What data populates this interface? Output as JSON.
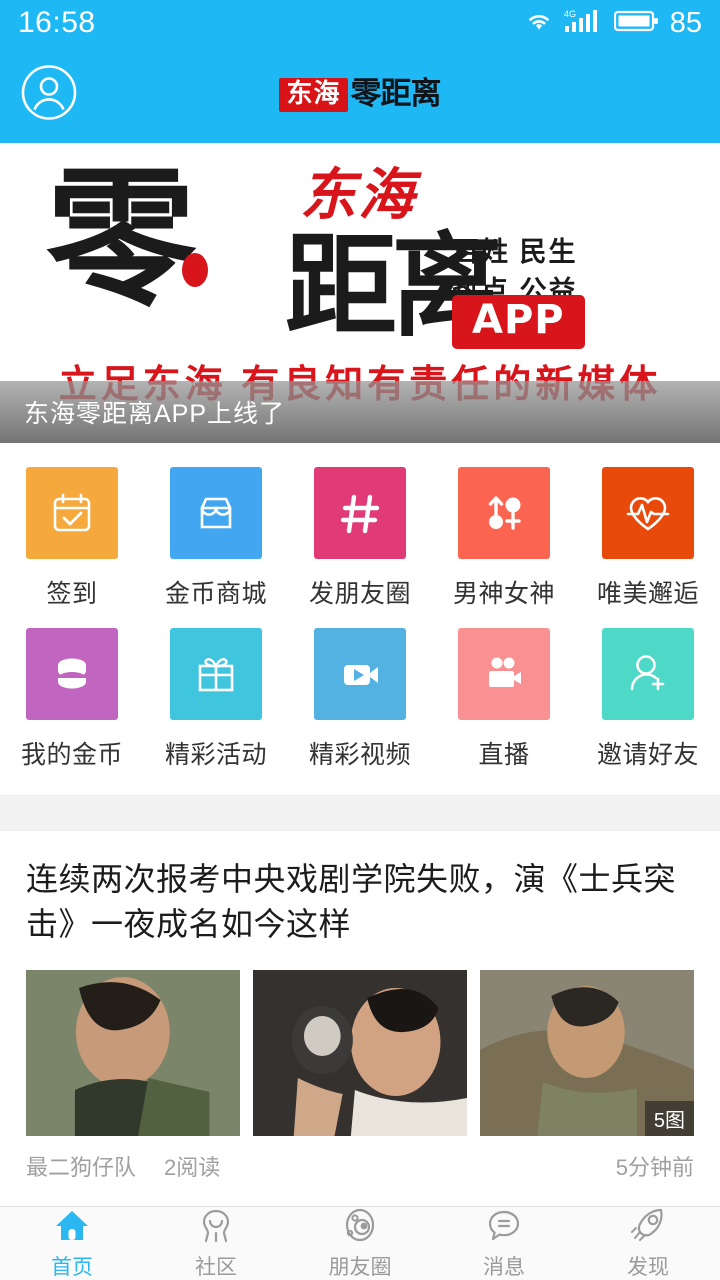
{
  "status_bar": {
    "time": "16:58",
    "battery_level": "85",
    "network_label": "4G",
    "icons": [
      "wifi-icon",
      "signal-icon",
      "battery-icon"
    ]
  },
  "header": {
    "avatar_icon": "user-avatar-icon",
    "logo_red_text": "东海",
    "logo_dark_text": "零距离"
  },
  "banner": {
    "zero_char": "零",
    "brand_script": "东海",
    "juli_char": "距离",
    "tag_line1": "百姓 民生",
    "tag_line2": "热点 公益",
    "app_badge": "APP",
    "slogan": "立足东海 有良知有责任的新媒体",
    "caption": "东海零距离APP上线了"
  },
  "grid": {
    "rows": [
      [
        {
          "label": "签到",
          "icon": "calendar-check-icon",
          "color": "#F5A83C"
        },
        {
          "label": "金币商城",
          "icon": "shop-icon",
          "color": "#42A7F0"
        },
        {
          "label": "发朋友圈",
          "icon": "hash-icon",
          "color": "#E03A77"
        },
        {
          "label": "男神女神",
          "icon": "gender-icon",
          "color": "#FB6450"
        },
        {
          "label": "唯美邂逅",
          "icon": "heart-pulse-icon",
          "color": "#E84A0C"
        }
      ],
      [
        {
          "label": "我的金币",
          "icon": "coins-stack-icon",
          "color": "#C066C0"
        },
        {
          "label": "精彩活动",
          "icon": "gift-icon",
          "color": "#3FC6DE"
        },
        {
          "label": "精彩视频",
          "icon": "video-play-icon",
          "color": "#54B2E2"
        },
        {
          "label": "直播",
          "icon": "movie-camera-icon",
          "color": "#F99091"
        },
        {
          "label": "邀请好友",
          "icon": "user-plus-icon",
          "color": "#4ED8C8"
        }
      ]
    ]
  },
  "news": {
    "title": "连续两次报考中央戏剧学院失败，演《士兵突击》一夜成名如今这样",
    "thumbnails": [
      {
        "alt": "man-in-plaid-shirt-photo",
        "badge": ""
      },
      {
        "alt": "man-holding-dog-photo",
        "badge": ""
      },
      {
        "alt": "soldier-in-uniform-photo",
        "badge": "5图"
      }
    ],
    "source": "最二狗仔队",
    "reads": "2阅读",
    "time": "5分钟前"
  },
  "tabbar": {
    "items": [
      {
        "label": "首页",
        "icon": "home-icon",
        "active": true
      },
      {
        "label": "社区",
        "icon": "community-icon",
        "active": false
      },
      {
        "label": "朋友圈",
        "icon": "moments-icon",
        "active": false
      },
      {
        "label": "消息",
        "icon": "message-icon",
        "active": false
      },
      {
        "label": "发现",
        "icon": "rocket-discover-icon",
        "active": false
      }
    ]
  },
  "colors": {
    "brand_blue": "#1EB9F5",
    "accent_red": "#D81317",
    "tab_active": "#2BB7F0"
  }
}
